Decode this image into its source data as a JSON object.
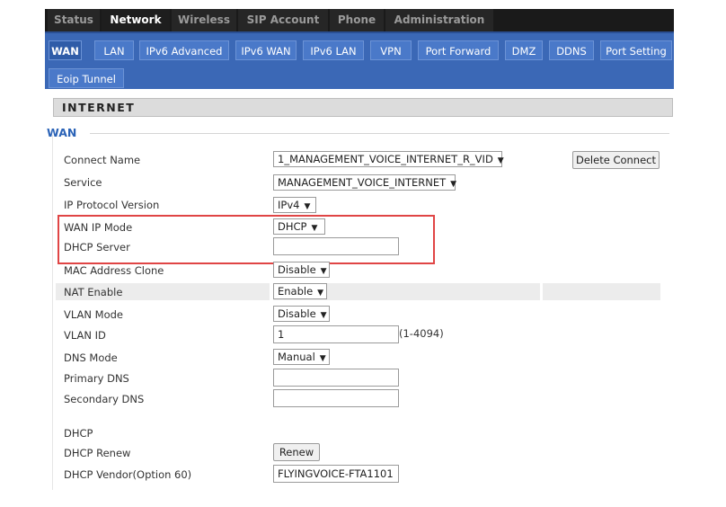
{
  "top_tabs": [
    "Status",
    "Network",
    "Wireless",
    "SIP Account",
    "Phone",
    "Administration"
  ],
  "sub_tabs_row1": [
    "WAN",
    "LAN",
    "IPv6 Advanced",
    "IPv6 WAN",
    "IPv6 LAN",
    "VPN",
    "Port Forward",
    "DMZ",
    "DDNS",
    "Port Setting"
  ],
  "sub_tabs_row2": [
    "Eoip Tunnel"
  ],
  "section": {
    "title": "INTERNET",
    "legend": "WAN"
  },
  "fields": {
    "connect_name": {
      "label": "Connect Name",
      "value": "1_MANAGEMENT_VOICE_INTERNET_R_VID"
    },
    "delete_connect": "Delete Connect",
    "service": {
      "label": "Service",
      "value": "MANAGEMENT_VOICE_INTERNET"
    },
    "ip_protocol": {
      "label": "IP Protocol Version",
      "value": "IPv4"
    },
    "wan_ip_mode": {
      "label": "WAN IP Mode",
      "value": "DHCP"
    },
    "dhcp_server": {
      "label": "DHCP Server",
      "value": ""
    },
    "mac_clone": {
      "label": "MAC Address Clone",
      "value": "Disable"
    },
    "nat_enable": {
      "label": "NAT Enable",
      "value": "Enable"
    },
    "vlan_mode": {
      "label": "VLAN Mode",
      "value": "Disable"
    },
    "vlan_id": {
      "label": "VLAN ID",
      "value": "1",
      "hint": "(1-4094)"
    },
    "dns_mode": {
      "label": "DNS Mode",
      "value": "Manual"
    },
    "primary_dns": {
      "label": "Primary DNS",
      "value": ""
    },
    "secondary_dns": {
      "label": "Secondary DNS",
      "value": ""
    },
    "dhcp_heading": "DHCP",
    "dhcp_renew": {
      "label": "DHCP Renew",
      "button": "Renew"
    },
    "vendor": {
      "label": "DHCP Vendor(Option 60)",
      "value": "FLYINGVOICE-FTA1101"
    }
  },
  "dropdown_arrow": "▼",
  "colors": {
    "nav_blue": "#3b68b6",
    "highlight_red": "#e04545",
    "legend_blue": "#2b63b7"
  }
}
